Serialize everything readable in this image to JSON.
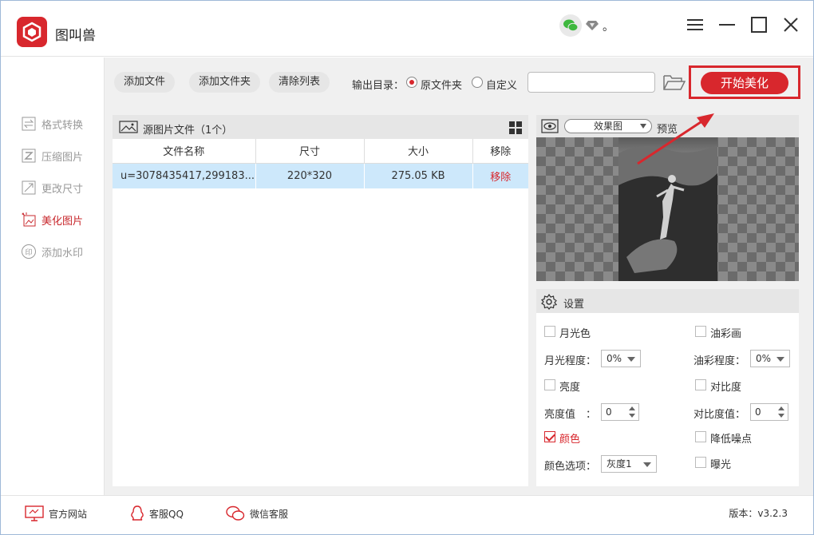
{
  "app": {
    "title": "图叫兽",
    "dot": "。"
  },
  "sidebar": {
    "items": [
      {
        "label": "格式转换",
        "icon": "format-convert-icon"
      },
      {
        "label": "压缩图片",
        "icon": "compress-icon"
      },
      {
        "label": "更改尺寸",
        "icon": "resize-icon"
      },
      {
        "label": "美化图片",
        "icon": "beautify-icon"
      },
      {
        "label": "添加水印",
        "icon": "watermark-icon"
      }
    ],
    "active_index": 3
  },
  "toolbar": {
    "add_file": "添加文件",
    "add_folder": "添加文件夹",
    "clear_list": "清除列表",
    "output_label": "输出目录：",
    "radio_original": "原文件夹",
    "radio_custom": "自定义",
    "output_path": "",
    "start_label": "开始美化"
  },
  "file_panel": {
    "title": "源图片文件（1个）",
    "columns": [
      "文件名称",
      "尺寸",
      "大小",
      "移除"
    ],
    "rows": [
      {
        "name": "u=3078435417,299183...",
        "size": "220*320",
        "filesize": "275.05 KB",
        "remove": "移除"
      }
    ]
  },
  "preview": {
    "select_value": "效果图",
    "label": "预览"
  },
  "settings": {
    "title": "设置",
    "moonlight": "月光色",
    "oil": "油彩画",
    "moonlight_level_label": "月光程度：",
    "moonlight_level_value": "0%",
    "oil_level_label": "油彩程度：",
    "oil_level_value": "0%",
    "brightness": "亮度",
    "contrast": "对比度",
    "brightness_value_label": "亮度值　：",
    "brightness_value": "0",
    "contrast_value_label": "对比度值：",
    "contrast_value": "0",
    "color": "颜色",
    "denoise": "降低噪点",
    "color_option_label": "颜色选项：",
    "color_option_value": "灰度1",
    "exposure": "曝光"
  },
  "footer": {
    "website": "官方网站",
    "qq": "客服QQ",
    "wechat": "微信客服",
    "version": "版本：v3.2.3"
  },
  "colors": {
    "accent": "#d8272d",
    "selected_row": "#cde8fb",
    "panel_head": "#e6e6e6"
  }
}
